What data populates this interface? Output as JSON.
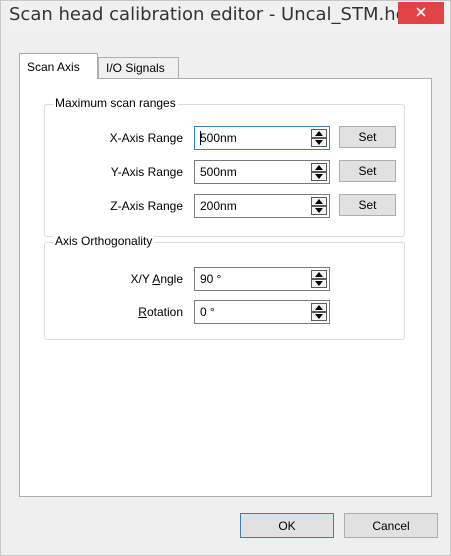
{
  "window": {
    "title": "Scan head calibration editor - Uncal_STM.hed",
    "close_icon": "close-icon"
  },
  "tabs": [
    {
      "label": "Scan Axis",
      "active": true
    },
    {
      "label": "I/O Signals",
      "active": false
    }
  ],
  "scan_ranges": {
    "group_label": "Maximum scan ranges",
    "rows": [
      {
        "label": "X-Axis Range",
        "value": "500nm",
        "button": "Set"
      },
      {
        "label": "Y-Axis Range",
        "value": "500nm",
        "button": "Set"
      },
      {
        "label": "Z-Axis Range",
        "value": "200nm",
        "button": "Set"
      }
    ]
  },
  "orthogonality": {
    "group_label": "Axis Orthogonality",
    "angle_label_pre": "X/Y ",
    "angle_label_accel": "A",
    "angle_label_post": "ngle",
    "angle_value": "90 °",
    "rotation_label_accel": "R",
    "rotation_label_post": "otation",
    "rotation_value": "0 °"
  },
  "footer": {
    "ok_label": "OK",
    "cancel_label": "Cancel"
  }
}
